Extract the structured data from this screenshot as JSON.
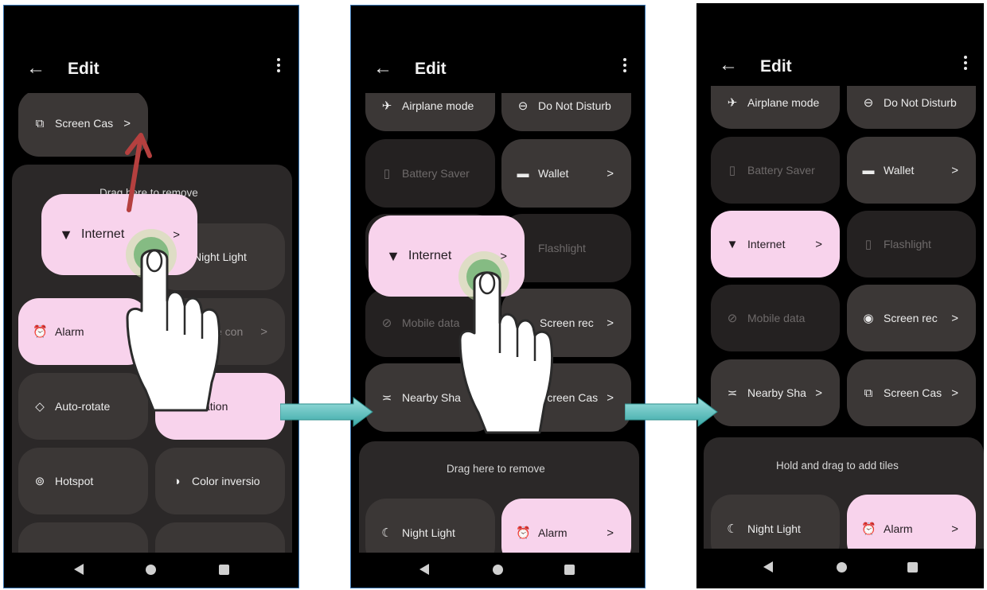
{
  "common": {
    "back_icon": "←",
    "chevron": ">"
  },
  "panel1": {
    "title": "Edit",
    "tiles": {
      "screen_cast": "Screen Cas",
      "night_light": "Night Light",
      "alarm": "Alarm",
      "device_controls": "e con",
      "auto_rotate": "Auto-rotate",
      "location": "cation",
      "hotspot": "Hotspot",
      "color_inversion": "Color inversio"
    },
    "drag_remove": "Drag here to remove",
    "dragged": "Internet"
  },
  "panel2": {
    "title": "Edit",
    "tiles": {
      "airplane": "Airplane mode",
      "dnd": "Do Not Disturb",
      "battery": "Battery Saver",
      "wallet": "Wallet",
      "flashlight": "Flashlight",
      "mobile_data": "Mobile data",
      "screen_record": "Screen rec",
      "nearby": "Nearby Sha",
      "screen_cast": "Screen Cas",
      "night_light": "Night Light",
      "alarm": "Alarm"
    },
    "drag_remove": "Drag here to remove",
    "dragged": "Internet"
  },
  "panel3": {
    "title": "Edit",
    "tiles": {
      "airplane": "Airplane mode",
      "dnd": "Do Not Disturb",
      "battery": "Battery Saver",
      "wallet": "Wallet",
      "internet": "Internet",
      "flashlight": "Flashlight",
      "mobile_data": "Mobile data",
      "screen_record": "Screen rec",
      "nearby": "Nearby Sha",
      "screen_cast": "Screen Cas",
      "night_light": "Night Light",
      "alarm": "Alarm"
    },
    "add_tiles": "Hold and drag to add tiles"
  },
  "colors": {
    "tile_on": "#f8d3ec",
    "tile_off": "#3b3736",
    "arrow_red": "#b5403f",
    "arrow_teal": "#5cc6c4"
  }
}
